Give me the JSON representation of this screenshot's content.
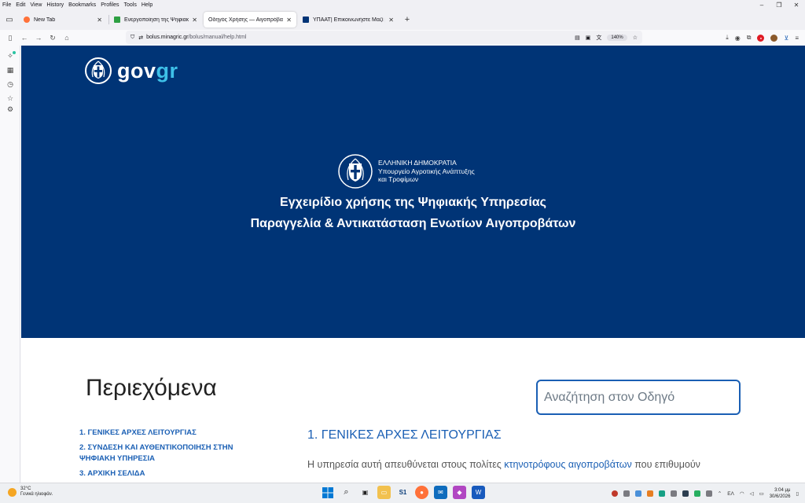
{
  "menubar": {
    "items": [
      "File",
      "Edit",
      "View",
      "History",
      "Bookmarks",
      "Profiles",
      "Tools",
      "Help"
    ],
    "minimize": "–",
    "maximize": "❐",
    "close": "✕"
  },
  "tabs": [
    {
      "title": "New Tab",
      "favicon_color": "#ff7139",
      "close": "✕"
    },
    {
      "title": "Ενεργοποίηση της Ψηφιακής Π",
      "favicon_color": "#2ea043",
      "close": "✕"
    },
    {
      "title": "Οδηγός Χρήσης — Αιγοπρόβατα",
      "favicon_color": "#ffffff",
      "close": "✕"
    },
    {
      "title": "ΥΠΑΑΤ| Επικοινωνήστε Μαζί μ",
      "favicon_color": "#003476",
      "close": "✕"
    }
  ],
  "newtab_label": "+",
  "navbar": {
    "url_host": "bolus.minagric.gr",
    "url_path": "/bolus/manual/help.html",
    "zoom": "140%"
  },
  "page": {
    "logo": {
      "gov": "gov",
      "gr": "gr"
    },
    "ministry_lines": [
      "ΕΛΛΗΝΙΚΗ ΔΗΜΟΚΡΑΤΙΑ",
      "Υπουργείο Αγροτικής Ανάπτυξης",
      "και Τροφίμων"
    ],
    "hero_title_1": "Εγχειρίδιο χρήσης της Ψηφιακής Υπηρεσίας",
    "hero_title_2": "Παραγγελία & Αντικατάσταση Ενωτίων Αιγοπροβάτων",
    "toc_heading": "Περιεχόμενα",
    "search_placeholder": "Αναζήτηση στον Οδηγό",
    "toc": [
      "1. ΓΕΝΙΚΕΣ ΑΡΧΕΣ ΛΕΙΤΟΥΡΓΙΑΣ",
      "2. ΣΥΝΔΕΣΗ ΚΑΙ ΑΥΘΕΝΤΙΚΟΠΟΙΗΣΗ ΣΤΗΝ ΨΗΦΙΑΚΗ ΥΠΗΡΕΣΙΑ",
      "3. ΑΡΧΙΚΗ ΣΕΛΙΔΑ"
    ],
    "section_title": "1. ΓΕΝΙΚΕΣ ΑΡΧΕΣ ΛΕΙΤΟΥΡΓΙΑΣ",
    "para_start": "Η υπηρεσία αυτή απευθύνεται στους πολίτες ",
    "para_link": "κτηνοτρόφους αιγοπροβάτων",
    "para_end": " που επιθυμούν"
  },
  "taskbar": {
    "temperature": "32°C",
    "weather": "Γενικά ηλιοφάν.",
    "language": "ΕΛ",
    "time": "3:04 μμ",
    "date": "30/6/2026"
  },
  "colors": {
    "hero_bg": "#003476",
    "link_blue": "#1a5fb4",
    "gr_cyan": "#3ec0e8"
  }
}
